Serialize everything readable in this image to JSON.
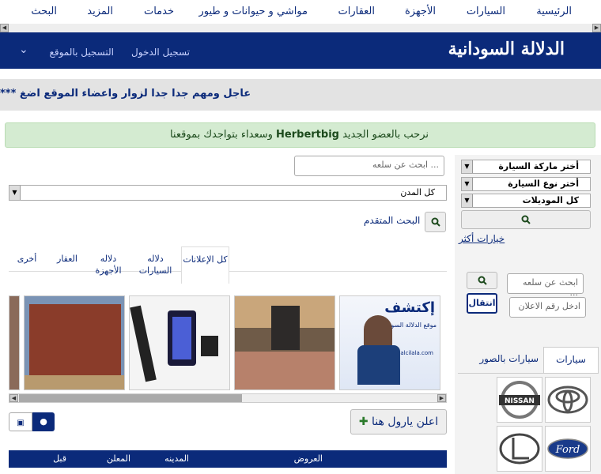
{
  "nav": {
    "home": "الرئيسية",
    "cars": "السيارات",
    "devices": "الأجهزة",
    "realestate": "العقارات",
    "livestock": "مواشي و حيوانات و طيور",
    "services": "خدمات",
    "more": "المزيد",
    "search": "البحث"
  },
  "header": {
    "logo": "الدلالة السودانية",
    "login": "تسجيل الدخول",
    "register": "التسجيل بالموقع"
  },
  "ticker": "*** عاجل ومهم جدا جدا لزوار واعضاء الموقع اضغ",
  "welcome": {
    "before": "نرحب بالعضو الجديد",
    "member": "Herbertbig",
    "after": "وسعداء بتواجدك بموقعنا"
  },
  "search": {
    "placeholder": "ابحث عن سلعه ...",
    "city": "كل المدن",
    "advanced": "البحث المتقدم"
  },
  "tabs": [
    "كل الإعلانات",
    "دلاله السيارات",
    "دلاله الأجهزة",
    "العقار",
    "أخرى"
  ],
  "thumbs": [
    {
      "title": "إكتشف",
      "caption": "موقع الدلالة السودانية",
      "site": "alcilala.com"
    }
  ],
  "advertise": "اعلن يارول هنا",
  "table": {
    "headers": [
      "العروض",
      "المدينه",
      "المعلن",
      "قبل"
    ]
  },
  "sidebar": {
    "make": "أختر ماركة السيارة",
    "type": "أختر نوع السيارة",
    "models": "كل الموديلات",
    "more_options": "خيارات أكثر",
    "search_placeholder": "ابحث عن سلعه ...",
    "ad_number_placeholder": "ادخل رقم الاعلان",
    "go": "انتقال",
    "tab_cars": "سيارات",
    "tab_photos": "سيارات بالصور",
    "brands": [
      "Toyota",
      "Nissan",
      "Ford",
      "Lexus"
    ]
  },
  "colors": {
    "brand": "#0b2a7a",
    "ticker_bg": "#e3e3e3",
    "welcome_bg": "#d4ebd1"
  }
}
